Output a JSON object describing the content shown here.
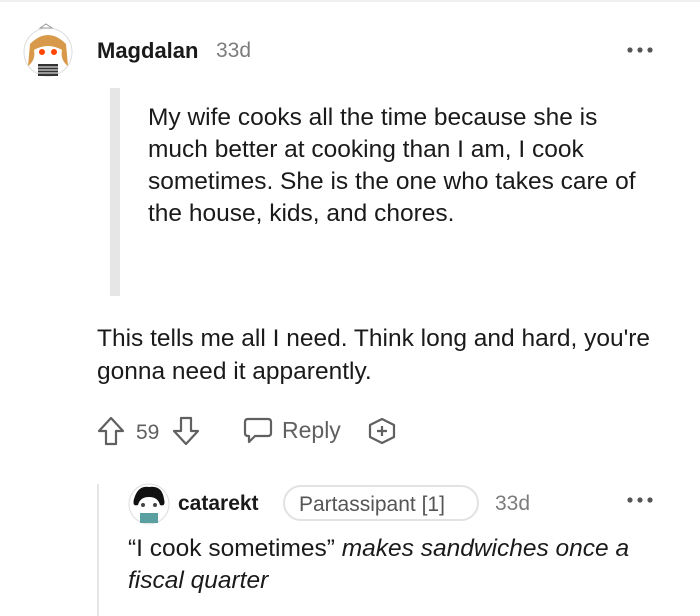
{
  "comment": {
    "username": "Magdalan",
    "time": "33d",
    "quote": "My wife cooks all the time because she is much better at cooking than I am, I cook sometimes. She is the one who takes care of the house, kids, and chores.",
    "body": "This tells me all I need. Think long and hard, you're gonna need it apparently.",
    "score": "59",
    "reply_label": "Reply",
    "avatar_icon": "snoo-avatar-icon",
    "more_icon": "more-options-icon"
  },
  "reply": {
    "username": "catarekt",
    "flair": "Partassipant [1]",
    "time": "33d",
    "text_plain": "“I cook sometimes” ",
    "text_italic": "makes sandwiches once a fiscal quarter"
  },
  "colors": {
    "text": "#1a1a1b",
    "meta": "#7c7c7c",
    "icon": "#606060",
    "quote_bar": "#e6e6e6"
  }
}
